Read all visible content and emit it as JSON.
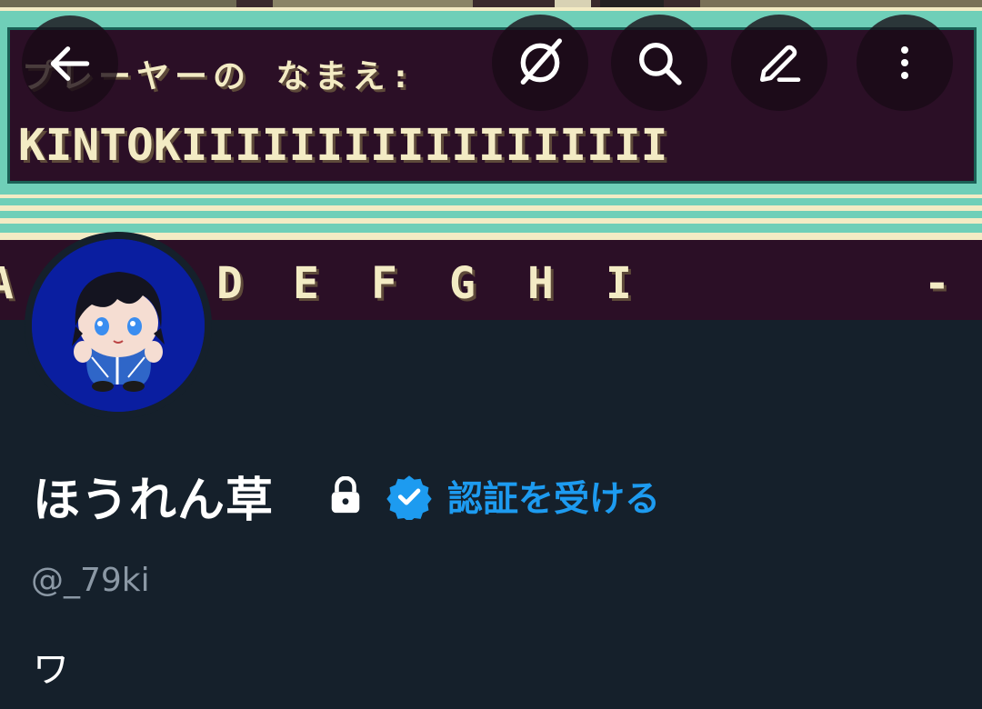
{
  "header": {
    "back_icon": "arrow-left-icon",
    "grok_icon": "grok-slash-circle-icon",
    "search_icon": "search-icon",
    "edit_icon": "pencil-icon",
    "more_icon": "more-vertical-icon"
  },
  "banner": {
    "prompt_text": "プレーヤーの なまえ:",
    "name_text": "KINTOKIIIIIIIIIIIIIIIIII",
    "letters": [
      "A",
      "D",
      "E",
      "F",
      "G",
      "H",
      "I",
      "-"
    ],
    "colors": {
      "background": "#2b0f26",
      "cream": "#f3ebc4",
      "teal": "#6fcfb8"
    }
  },
  "profile": {
    "display_name": "ほうれん草",
    "lock_icon": "lock-icon",
    "verified_badge_icon": "verified-badge-icon",
    "verify_link": "認証を受ける",
    "handle": "@_79ki",
    "bio": "ワ"
  },
  "colors": {
    "background": "#15202b",
    "accent": "#1d9bf0",
    "text_primary": "#ffffff",
    "text_secondary": "#8b98a5"
  }
}
